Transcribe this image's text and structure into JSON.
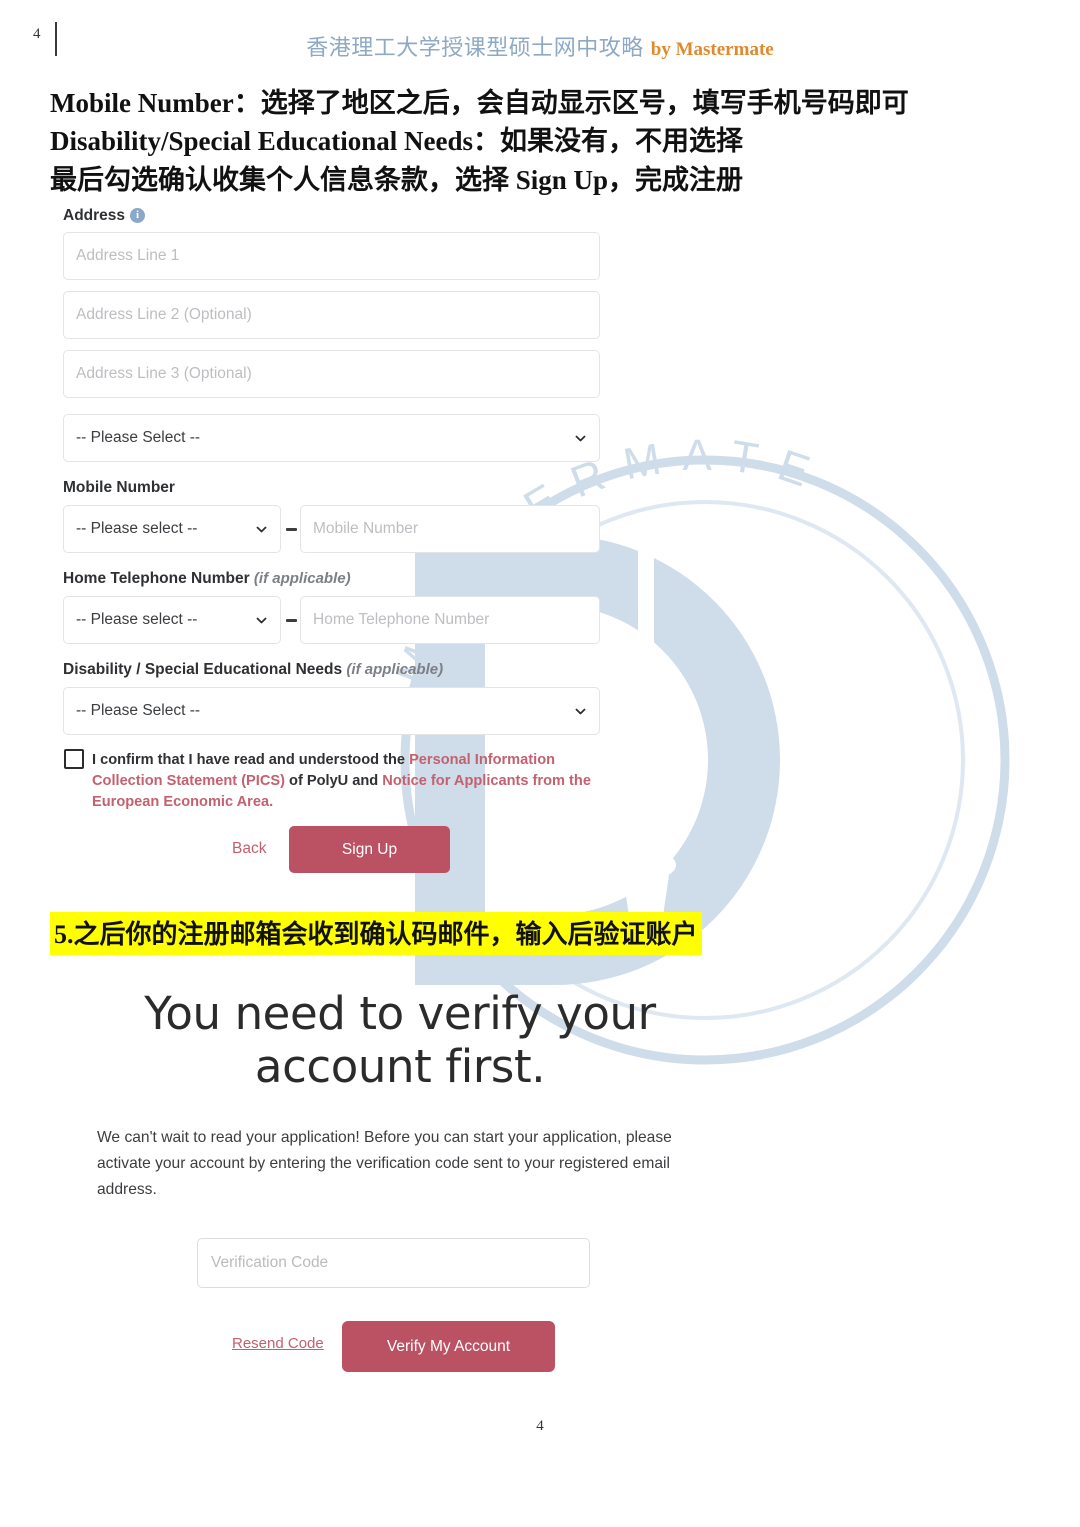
{
  "header": {
    "corner_page_number": "4",
    "title_cn": "香港理工大学授课型硕士网中攻略",
    "title_en": "by Mastermate",
    "title_cn_color": "#8fa8c4",
    "title_en_color": "#e08a2e"
  },
  "intro_lines": [
    "Mobile Number：选择了地区之后，会自动显示区号，填写手机号码即可",
    "Disability/Special Educational Needs：如果没有，不用选择",
    "最后勾选确认收集个人信息条款，选择 Sign Up，完成注册"
  ],
  "signup_form": {
    "address_label": "Address",
    "address_info_icon": "info-icon",
    "address_line1_placeholder": "Address Line 1",
    "address_line2_placeholder": "Address Line 2 (Optional)",
    "address_line3_placeholder": "Address Line 3 (Optional)",
    "country_select_value": "-- Please Select --",
    "mobile_label": "Mobile Number",
    "mobile_code_value": "-- Please select --",
    "mobile_placeholder": "Mobile Number",
    "home_tel_label": "Home Telephone Number",
    "home_tel_label_note": "(if applicable)",
    "home_tel_code_value": "-- Please select --",
    "home_tel_placeholder": "Home Telephone Number",
    "disability_label": "Disability / Special Educational Needs",
    "disability_label_note": "(if applicable)",
    "disability_select_value": "-- Please Select --",
    "consent": {
      "part1": "I confirm that I have read and understood the ",
      "link1": "Personal Information Collection Statement (PICS)",
      "part2": " of PolyU and ",
      "link2": "Notice for Applicants from the European Economic Area",
      "part3": "."
    },
    "back_label": "Back",
    "signup_label": "Sign Up",
    "accent_color": "#bb5263",
    "link_color": "#c4616f"
  },
  "highlight_line": "5.之后你的注册邮箱会收到确认码邮件，输入后验证账户",
  "verify_block": {
    "title": "You need to verify your account first.",
    "paragraph": "We can't wait to read your application! Before you can start your application, please activate your account by entering the verification code sent to your registered email address.",
    "code_placeholder": "Verification Code",
    "resend_label": "Resend Code",
    "verify_button_label": "Verify My Account"
  },
  "watermark": {
    "text": "MASTERMATE",
    "color": "#cfdcea"
  },
  "footer": {
    "page_number": "4"
  }
}
